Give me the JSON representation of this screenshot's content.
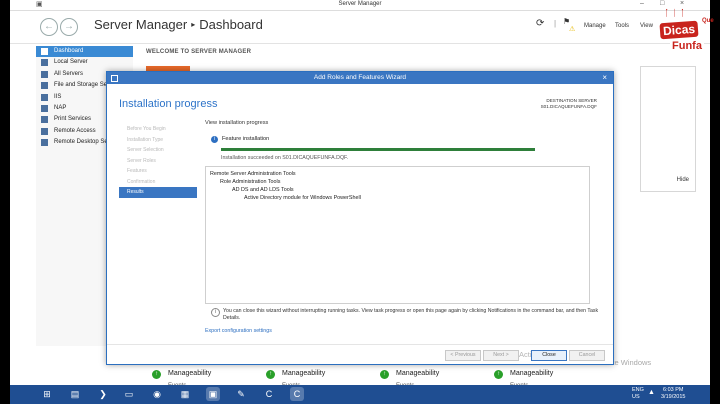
{
  "window": {
    "title": "Server Manager"
  },
  "header": {
    "app": "Server Manager",
    "separator": "▸",
    "page": "Dashboard",
    "menu": {
      "manage": "Manage",
      "tools": "Tools",
      "view": "View"
    }
  },
  "sidebar": {
    "items": [
      {
        "label": "Dashboard",
        "icon": "dashboard-icon"
      },
      {
        "label": "Local Server",
        "icon": "server-icon"
      },
      {
        "label": "All Servers",
        "icon": "servers-icon"
      },
      {
        "label": "File and Storage Services",
        "icon": "storage-icon"
      },
      {
        "label": "IIS",
        "icon": "iis-icon"
      },
      {
        "label": "NAP",
        "icon": "nap-icon"
      },
      {
        "label": "Print Services",
        "icon": "printer-icon"
      },
      {
        "label": "Remote Access",
        "icon": "remote-access-icon"
      },
      {
        "label": "Remote Desktop Services",
        "icon": "remote-desktop-icon"
      }
    ]
  },
  "main": {
    "welcome": "WELCOME TO SERVER MANAGER",
    "hide": "Hide",
    "tiles": [
      {
        "label": "Manageability",
        "events": "Events"
      },
      {
        "label": "Manageability",
        "events": "Events"
      },
      {
        "label": "Manageability",
        "events": "Events"
      },
      {
        "label": "Manageability",
        "events": "Events"
      }
    ]
  },
  "wizard": {
    "title": "Add Roles and Features Wizard",
    "heading": "Installation progress",
    "destination_label": "DESTINATION SERVER",
    "destination_server": "S01.DICAQUEFUNFA.DQF",
    "steps": [
      "Before You Begin",
      "Installation Type",
      "Server Selection",
      "Server Roles",
      "Features",
      "Confirmation",
      "Results"
    ],
    "active_step": "Results",
    "view_progress": "View installation progress",
    "feature_installation": "Feature installation",
    "progress": 1.0,
    "success_text": "Installation succeeded on S01.DICAQUEFUNFA.DQF.",
    "results": [
      {
        "text": "Remote Server Administration Tools",
        "level": 0
      },
      {
        "text": "Role Administration Tools",
        "level": 1
      },
      {
        "text": "AD DS and AD LDS Tools",
        "level": 2
      },
      {
        "text": "Active Directory module for Windows PowerShell",
        "level": 3
      }
    ],
    "note": "You can close this wizard without interrupting running tasks. View task progress or open this page again by clicking Notifications in the command bar, and then Task Details.",
    "export_link": "Export configuration settings",
    "buttons": {
      "previous": "< Previous",
      "next": "Next >",
      "close": "Close",
      "cancel": "Cancel"
    }
  },
  "watermark": "Activate Windows",
  "watermark_partial": "Activate Wi",
  "taskbar": {
    "lang": "ENG",
    "region": "US",
    "time": "6:03 PM",
    "date": "3/19/2015"
  },
  "logo": {
    "line1": "Dicas",
    "line2": "Que",
    "line3": "Funfa"
  },
  "colors": {
    "accent": "#3a76c2",
    "sidebar_active": "#3a8ad4",
    "success": "#2e7f3a",
    "brand_red": "#c8241d",
    "taskbar": "#1f4e92"
  }
}
